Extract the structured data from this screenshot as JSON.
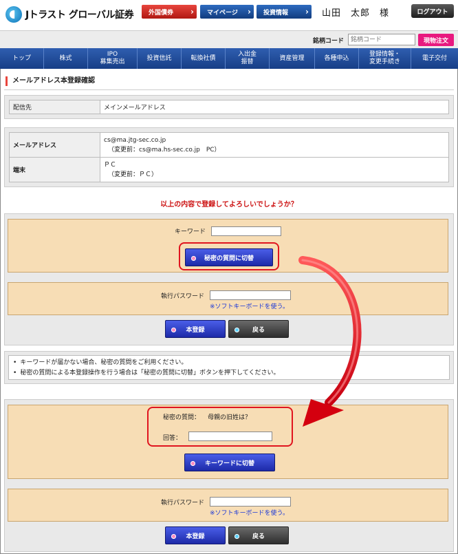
{
  "header": {
    "logo_text": "Jトラスト グローバル証券",
    "btn_foreign_bonds": "外国債券",
    "btn_mypage": "マイページ",
    "btn_invest_info": "投資情報",
    "user_name": "山田　太郎　様",
    "logout": "ログアウト"
  },
  "search": {
    "code_label": "銘柄コード",
    "code_placeholder": "銘柄コード",
    "order_button": "現物注文"
  },
  "nav": [
    {
      "label": "トップ"
    },
    {
      "label": "株式"
    },
    {
      "label": "IPO\n募集売出"
    },
    {
      "label": "投資信託"
    },
    {
      "label": "転換社債"
    },
    {
      "label": "入出金\n振替"
    },
    {
      "label": "資産管理"
    },
    {
      "label": "各種申込"
    },
    {
      "label": "登録情報・\n変更手続き"
    },
    {
      "label": "電子交付"
    }
  ],
  "page_title": "メールアドレス本登録確認",
  "delivery": {
    "label": "配信先",
    "value": "メインメールアドレス"
  },
  "email_row": {
    "label": "メールアドレス",
    "value": "cs@ma.jtg-sec.co.jp",
    "previous": "（変更前：cs@ma.hs-sec.co.jp　PC）"
  },
  "device_row": {
    "label": "端末",
    "value": "ＰＣ",
    "previous": "（変更前：ＰＣ）"
  },
  "confirm_question": "以上の内容で登録してよろしいでしょうか？",
  "form1": {
    "keyword_label": "キーワード",
    "switch_button": "秘密の質問に切替",
    "password_label": "執行パスワード",
    "soft_keyboard": "※ソフトキーボードを使う。",
    "register_button": "本登録",
    "back_button": "戻る"
  },
  "notes": [
    "キーワードが届かない場合、秘密の質問をご利用ください。",
    "秘密の質問による本登録操作を行う場合は「秘密の質問に切替」ボタンを押下してください。"
  ],
  "form2": {
    "secret_label": "秘密の質問：",
    "secret_question": "母親の旧姓は？",
    "answer_label": "回答：",
    "switch_button": "キーワードに切替",
    "password_label": "執行パスワード",
    "soft_keyboard": "※ソフトキーボードを使う。",
    "register_button": "本登録",
    "back_button": "戻る"
  },
  "colors": {
    "nav_blue": "#1f4a98",
    "panel_orange": "#f7ddb5",
    "accent_red": "#e0141e",
    "link_blue": "#1a37d8"
  }
}
